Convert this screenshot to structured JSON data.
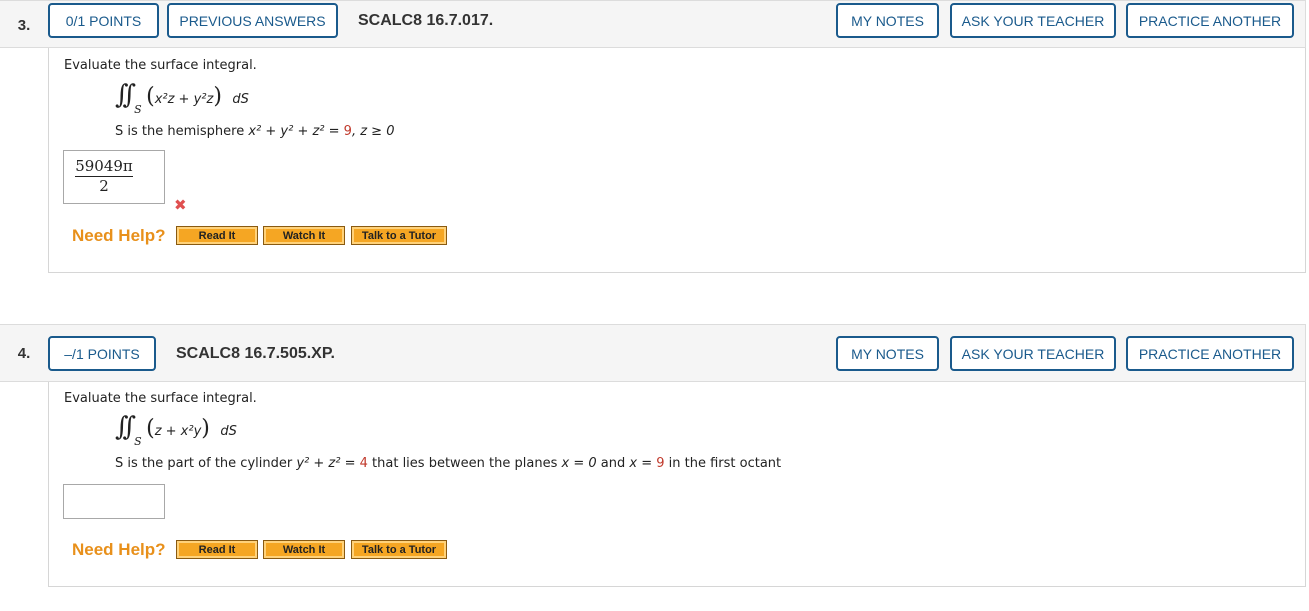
{
  "q3": {
    "number": "3.",
    "points_label": "0/1 POINTS",
    "previous_answers_label": "PREVIOUS ANSWERS",
    "code": "SCALC8 16.7.017.",
    "my_notes_label": "MY NOTES",
    "ask_teacher_label": "ASK YOUR TEACHER",
    "practice_label": "PRACTICE ANOTHER",
    "prompt": "Evaluate the surface integral.",
    "integrand": "x²z + y²z",
    "surface": "S",
    "differential": "dS",
    "condition_prefix": "S is the hemisphere",
    "condition_eq": "x² + y² + z² =",
    "condition_value": "9",
    "condition_suffix": ", z ≥ 0",
    "answer_numerator": "59049π",
    "answer_denominator": "2",
    "answer_status": "incorrect",
    "need_help_label": "Need Help?",
    "read_it_label": "Read It",
    "watch_it_label": "Watch It",
    "tutor_label": "Talk to a Tutor"
  },
  "q4": {
    "number": "4.",
    "points_label": "–/1 POINTS",
    "code": "SCALC8 16.7.505.XP.",
    "my_notes_label": "MY NOTES",
    "ask_teacher_label": "ASK YOUR TEACHER",
    "practice_label": "PRACTICE ANOTHER",
    "prompt": "Evaluate the surface integral.",
    "integrand": "z + x²y",
    "surface": "S",
    "differential": "dS",
    "condition_prefix": "S is the part of the cylinder",
    "condition_eq": "y² + z² =",
    "condition_value": "4",
    "condition_mid": "that lies between the planes",
    "plane1": "x = 0",
    "and_label": "and",
    "plane2_prefix": "x =",
    "plane2_value": "9",
    "condition_suffix": "in the first octant",
    "answer_value": "",
    "need_help_label": "Need Help?",
    "read_it_label": "Read It",
    "watch_it_label": "Watch It",
    "tutor_label": "Talk to a Tutor"
  },
  "colors": {
    "button_border": "#1a5a8c",
    "need_help": "#e8901b",
    "help_button": "#f5a623",
    "highlight_value": "#c0392b",
    "incorrect_mark": "#e05050"
  }
}
